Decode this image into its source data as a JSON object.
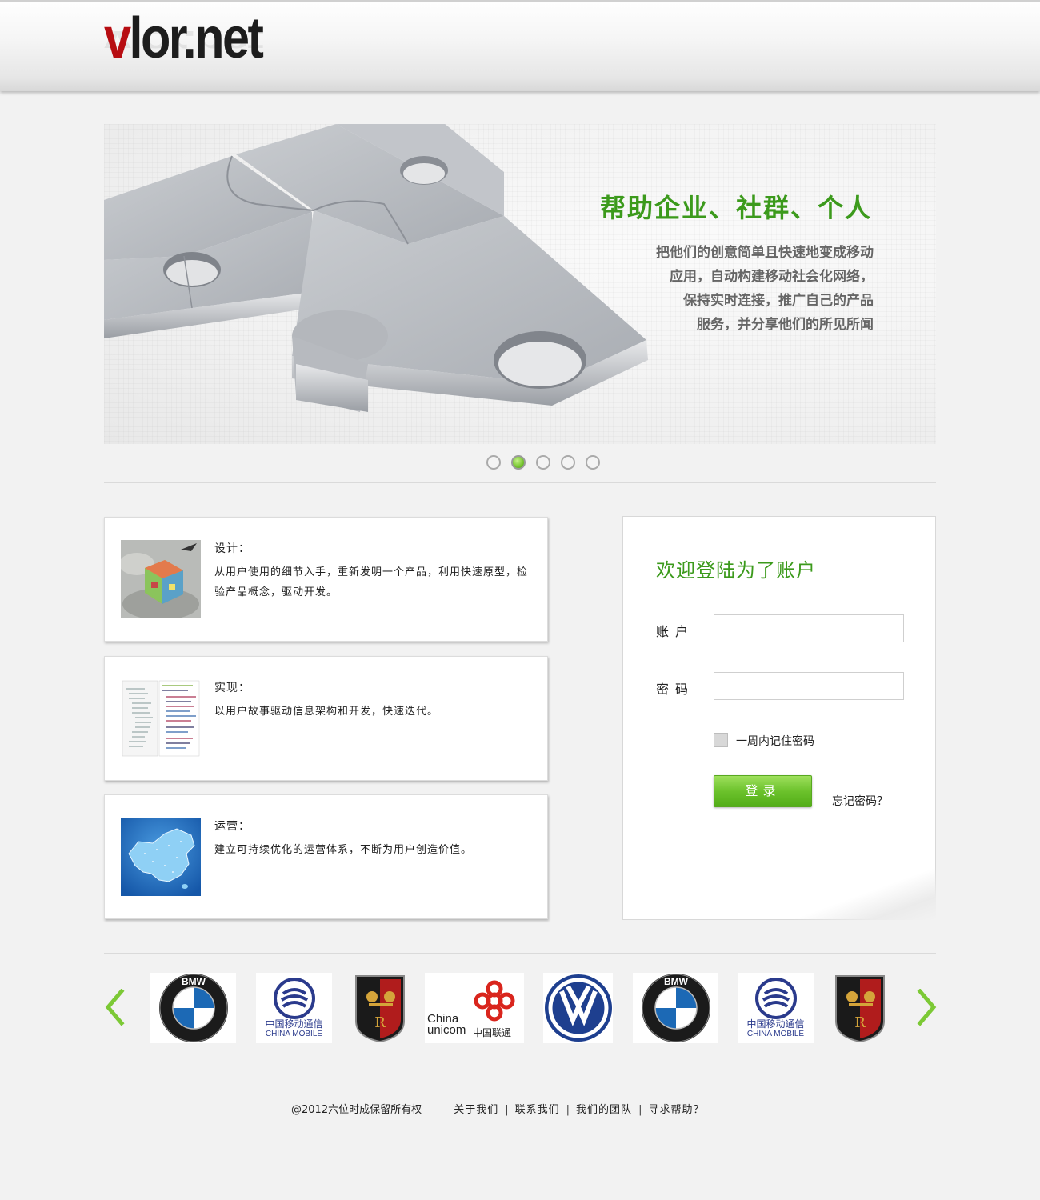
{
  "header": {
    "logo_v": "v",
    "logo_rest": "lor.net",
    "logo_full": "vlor.net"
  },
  "banner": {
    "headline": "帮助企业、社群、个人",
    "lines": [
      "把他们的创意简单且快速地变成移动",
      "应用，自动构建移动社会化网络，",
      "保持实时连接，推广自己的产品",
      "服务，并分享他们的所见所闻"
    ],
    "slide_count": 5,
    "active_slide": 2
  },
  "features": [
    {
      "title": "设计：",
      "text": "从用户使用的细节入手，重新发明一个产品，利用快速原型，检验产品概念，驱动开发。",
      "thumb": "design-cube-image"
    },
    {
      "title": "实现：",
      "text": "以用户故事驱动信息架构和开发，快速迭代。",
      "thumb": "code-editor-screenshot"
    },
    {
      "title": "运营：",
      "text": "建立可持续优化的运营体系，不断为用户创造价值。",
      "thumb": "china-map-image"
    }
  ],
  "login": {
    "title": "欢迎登陆为了账户",
    "account_label": "账户",
    "password_label": "密码",
    "account_value": "",
    "password_value": "",
    "remember_label": "一周内记住密码",
    "submit_label": "登录",
    "forgot_label": "忘记密码？"
  },
  "partners": {
    "logos": [
      "bmw-logo",
      "china-mobile-logo",
      "roewe-logo",
      "china-unicom-logo",
      "volkswagen-logo",
      "bmw-logo",
      "china-mobile-logo",
      "roewe-logo"
    ],
    "china_mobile_cn": "中国移动通信",
    "china_mobile_en": "CHINA MOBILE",
    "unicom_en_1": "China",
    "unicom_en_2": "unicom",
    "unicom_cn": "中国联通",
    "bmw_text": "BMW"
  },
  "footer": {
    "copyright": "@2012六位时成保留所有权",
    "links": [
      "关于我们",
      "联系我们",
      "我们的团队",
      "寻求帮助？"
    ]
  },
  "colors": {
    "accent_green": "#3c9a1c",
    "logo_red": "#b70d12",
    "arrow_green": "#7cc935"
  }
}
